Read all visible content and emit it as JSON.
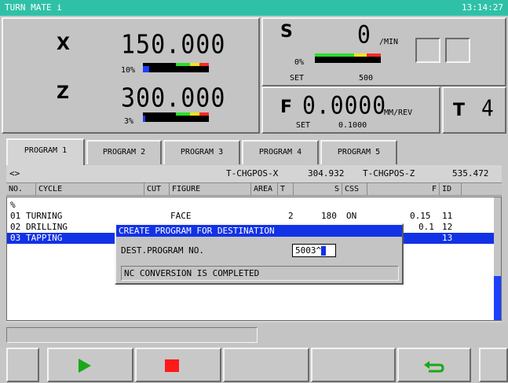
{
  "titlebar": {
    "app_name": "TURN MATE i",
    "clock": "13:14:27"
  },
  "positions": {
    "x": {
      "axis": "X",
      "value": "150.000",
      "load": "10%",
      "load_fraction": 0.1
    },
    "z": {
      "axis": "Z",
      "value": "300.000",
      "load": "3%",
      "load_fraction": 0.03
    }
  },
  "spindle": {
    "label": "S",
    "value": "0",
    "unit": "/MIN",
    "load": "0%",
    "load_fraction": 0.0,
    "set_label": "SET",
    "set_value": "500"
  },
  "feed": {
    "label": "F",
    "value": "0.0000",
    "unit": "MM/REV",
    "set_label": "SET",
    "set_value": "0.1000"
  },
  "tool": {
    "label": "T",
    "value": "4"
  },
  "tabs": [
    {
      "label": "PROGRAM 1",
      "active": true
    },
    {
      "label": "PROGRAM 2",
      "active": false
    },
    {
      "label": "PROGRAM 3",
      "active": false
    },
    {
      "label": "PROGRAM 4",
      "active": false
    },
    {
      "label": "PROGRAM 5",
      "active": false
    }
  ],
  "infobar": {
    "bracket": "<>",
    "chgpos_x_label": "T-CHGPOS-X",
    "chgpos_x_value": "304.932",
    "chgpos_z_label": "T-CHGPOS-Z",
    "chgpos_z_value": "535.472"
  },
  "table": {
    "headers": {
      "no": "NO.",
      "cycle": "CYCLE",
      "cut": "CUT",
      "figure": "FIGURE",
      "area": "AREA",
      "t": "T",
      "s": "S",
      "css": "CSS",
      "f": "F",
      "id": "ID"
    },
    "start_marker": "%",
    "rows": [
      {
        "no": "01",
        "cycle": "TURNING",
        "cut": "",
        "figure": "FACE",
        "area": "",
        "t": "2",
        "s": "180",
        "css": "ON",
        "f": "0.15",
        "id": "11",
        "selected": false
      },
      {
        "no": "02",
        "cycle": "DRILLING",
        "cut": "",
        "figure": "",
        "area": "",
        "t": "",
        "s": "",
        "css": "",
        "f": "0.1",
        "id": "12",
        "selected": false
      },
      {
        "no": "03",
        "cycle": "TAPPING",
        "cut": "",
        "figure": "",
        "area": "",
        "t": "",
        "s": "",
        "css": "",
        "f": "",
        "id": "13",
        "selected": true
      }
    ]
  },
  "dialog": {
    "title": "CREATE PROGRAM FOR DESTINATION",
    "field_label": "DEST.PROGRAM NO.",
    "field_value": "5003^",
    "status": "NC CONVERSION IS COMPLETED"
  },
  "softkeys": [
    {
      "name": "softkey-blank-left",
      "icon": ""
    },
    {
      "name": "softkey-start",
      "icon": "play-icon"
    },
    {
      "name": "softkey-stop",
      "icon": "stop-icon"
    },
    {
      "name": "softkey-blank-4",
      "icon": ""
    },
    {
      "name": "softkey-blank-5",
      "icon": ""
    },
    {
      "name": "softkey-return",
      "icon": "return-icon"
    },
    {
      "name": "softkey-blank-right",
      "icon": ""
    }
  ],
  "colors": {
    "title_bg": "#2fc1a8",
    "selection": "#1232e6",
    "bar_fill": "#1d3fff",
    "play": "#1aa81a",
    "stop": "#ff1a1a",
    "return": "#1aa81a"
  }
}
